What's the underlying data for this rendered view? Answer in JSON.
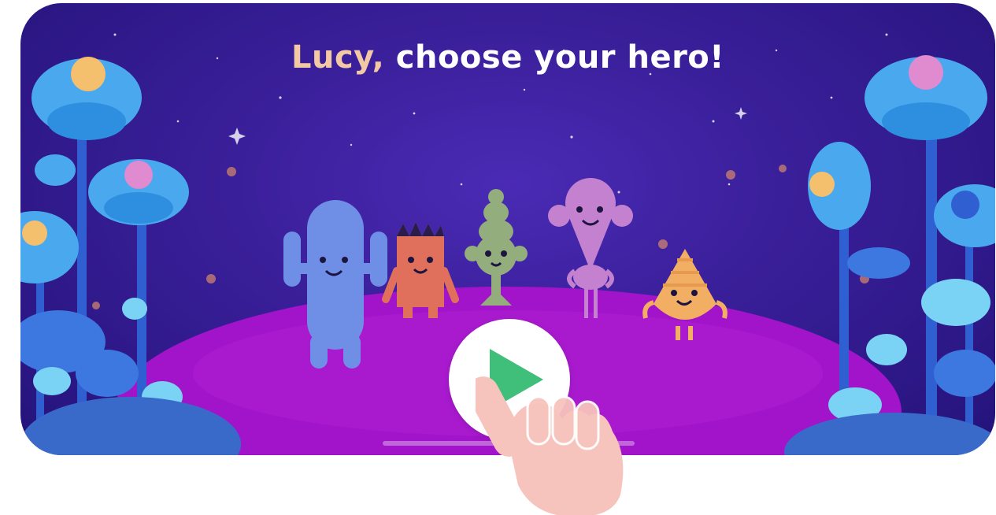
{
  "title": {
    "name": "Lucy,",
    "text": "choose your hero!"
  },
  "play_button": {
    "icon": "play-icon",
    "color": "#3fbf7a"
  },
  "characters": [
    {
      "id": "blue-cactus-hero",
      "color": "#6f8fe6"
    },
    {
      "id": "red-spiky-hero",
      "color": "#e0705c"
    },
    {
      "id": "green-sprout-hero",
      "color": "#93ad7d"
    },
    {
      "id": "pink-lollipop-hero",
      "color": "#c481cf"
    },
    {
      "id": "orange-pinecone-hero",
      "color": "#f2ae63"
    }
  ],
  "colors": {
    "sky": "#3a1f9a",
    "ground": "#a114c9",
    "flower": "#4aa9ee"
  }
}
